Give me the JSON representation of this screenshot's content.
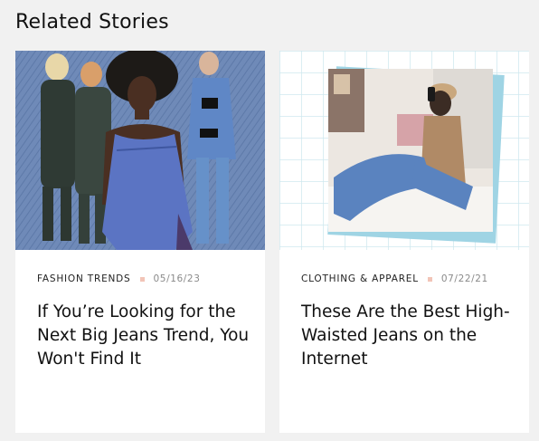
{
  "section": {
    "title": "Related Stories"
  },
  "stories": [
    {
      "category": "FASHION TRENDS",
      "date": "05/16/23",
      "headline": "If You’re Looking for the Next Big Jeans Trend, You Won't Find It",
      "image_alt": "Collage of women in denim outfits on a denim background"
    },
    {
      "category": "CLOTHING & APPAREL",
      "date": "07/22/21",
      "headline": "These Are the Best High-Waisted Jeans on the Internet",
      "image_alt": "Woman in high-waisted jeans taking a mirror selfie"
    }
  ],
  "colors": {
    "page_bg": "#f1f1f1",
    "card_bg": "#ffffff",
    "dot": "#f2c4b7",
    "denim_bg": "#6d88b5",
    "grid_accent": "#9cd3e4"
  }
}
